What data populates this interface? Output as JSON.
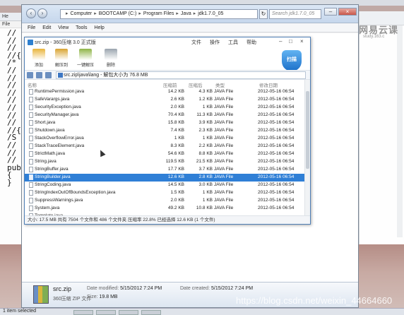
{
  "background_editor": {
    "tab_label": "He",
    "tab2_label": "File",
    "code_lines": [
      "//",
      "//",
      "//",
      "//{",
      "/*",
      "//",
      "//",
      "//",
      "//",
      "//",
      "//",
      "//",
      "//",
      "//{",
      "/S",
      "//",
      "//",
      "//",
      "pub",
      "{",
      "",
      "",
      "",
      "",
      "",
      "}"
    ]
  },
  "explorer": {
    "back_label": "‹",
    "forward_label": "›",
    "address_crumbs": [
      "Computer",
      "BOOTCAMP (C:)",
      "Program Files",
      "Java",
      "jdk1.7.0_05"
    ],
    "search_placeholder": "Search jdk1.7.0_05",
    "menu": [
      "File",
      "Edit",
      "View",
      "Tools",
      "Help"
    ],
    "details": {
      "file_name": "src.zip",
      "file_type": "360压缩 ZIP 文件",
      "date_modified_label": "Date modified:",
      "date_modified": "5/15/2012 7:24 PM",
      "size_label": "Size:",
      "size": "19.8 MB",
      "date_created_label": "Date created:",
      "date_created": "5/15/2012 7:24 PM"
    }
  },
  "zip_window": {
    "title": "src.zip - 360压缩 3.0 正式版",
    "menu": [
      "文件",
      "操作",
      "工具",
      "帮助"
    ],
    "toolbar": [
      {
        "label": "添加",
        "color": "#e9b43a"
      },
      {
        "label": "解压到",
        "color": "#d9a330"
      },
      {
        "label": "一键解压",
        "color": "#8fb447"
      },
      {
        "label": "删除",
        "color": "#9aa4ae"
      }
    ],
    "scan_label": "扫描",
    "path": "src.zip\\java\\lang - 解包大小为 76.8 MB",
    "columns": [
      "名称",
      "压缩前",
      "压缩后",
      "类型",
      "修改日期"
    ],
    "rows": [
      {
        "name": "RuntimePermission.java",
        "before": "14.2 KB",
        "after": "4.3 KB",
        "type": "JAVA File",
        "date": "2012-05-16 06:54"
      },
      {
        "name": "SafeVarargs.java",
        "before": "2.6 KB",
        "after": "1.2 KB",
        "type": "JAVA File",
        "date": "2012-05-16 06:54"
      },
      {
        "name": "SecurityException.java",
        "before": "2.0 KB",
        "after": "1 KB",
        "type": "JAVA File",
        "date": "2012-05-16 06:54"
      },
      {
        "name": "SecurityManager.java",
        "before": "70.4 KB",
        "after": "11.3 KB",
        "type": "JAVA File",
        "date": "2012-05-16 06:54"
      },
      {
        "name": "Short.java",
        "before": "15.8 KB",
        "after": "3.9 KB",
        "type": "JAVA File",
        "date": "2012-05-16 06:54"
      },
      {
        "name": "Shutdown.java",
        "before": "7.4 KB",
        "after": "2.3 KB",
        "type": "JAVA File",
        "date": "2012-05-16 06:54"
      },
      {
        "name": "StackOverflowError.java",
        "before": "1 KB",
        "after": "1 KB",
        "type": "JAVA File",
        "date": "2012-05-16 06:54"
      },
      {
        "name": "StackTraceElement.java",
        "before": "8.3 KB",
        "after": "2.2 KB",
        "type": "JAVA File",
        "date": "2012-05-16 06:54"
      },
      {
        "name": "StrictMath.java",
        "before": "54.6 KB",
        "after": "8.8 KB",
        "type": "JAVA File",
        "date": "2012-05-16 06:54"
      },
      {
        "name": "String.java",
        "before": "119.5 KB",
        "after": "21.5 KB",
        "type": "JAVA File",
        "date": "2012-05-16 06:54"
      },
      {
        "name": "StringBuffer.java",
        "before": "17.7 KB",
        "after": "3.7 KB",
        "type": "JAVA File",
        "date": "2012-05-16 06:54"
      },
      {
        "name": "StringBuilder.java",
        "before": "12.6 KB",
        "after": "2.8 KB",
        "type": "JAVA File",
        "date": "2012-05-16 06:54"
      },
      {
        "name": "StringCoding.java",
        "before": "14.5 KB",
        "after": "3.0 KB",
        "type": "JAVA File",
        "date": "2012-05-16 06:54"
      },
      {
        "name": "StringIndexOutOfBoundsException.java",
        "before": "1.5 KB",
        "after": "1 KB",
        "type": "JAVA File",
        "date": "2012-05-16 06:54"
      },
      {
        "name": "SuppressWarnings.java",
        "before": "2.0 KB",
        "after": "1 KB",
        "type": "JAVA File",
        "date": "2012-05-16 06:54"
      },
      {
        "name": "System.java",
        "before": "49.2 KB",
        "after": "10.8 KB",
        "type": "JAVA File",
        "date": "2012-05-16 06:54"
      },
      {
        "name": "Template.java",
        "before": "",
        "after": "",
        "type": "",
        "date": ""
      }
    ],
    "selected_row": "StringBuilder.java",
    "status": "大小: 17.5 MB 共有 7504 个文件和 486 个文件夹 压缩率 22.8% 已经选择 12.6 KB (1 个文件)"
  },
  "status_bar": "1 item selected",
  "watermark": {
    "logo_text": "网易云课",
    "logo_sub": "study.163.c",
    "url": "https://blog.csdn.net/weixin_44664660"
  },
  "colors": {
    "selection": "#2f7fd6",
    "zip_border": "#4f7fb6",
    "explorer_title": "#c6d7ec"
  }
}
